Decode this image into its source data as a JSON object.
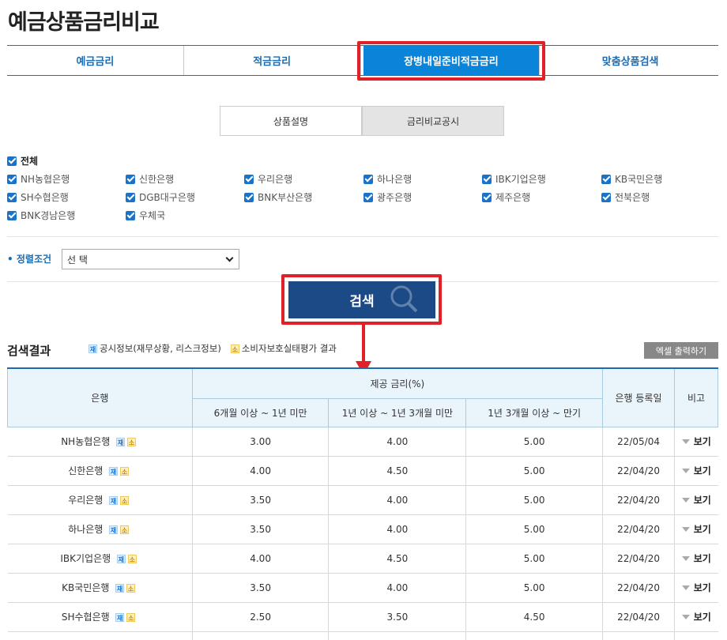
{
  "page": {
    "title": "예금상품금리비교"
  },
  "main_tabs": [
    {
      "label": "예금금리"
    },
    {
      "label": "적금금리"
    },
    {
      "label": "장병내일준비적금금리",
      "active": true
    },
    {
      "label": "맞춤상품검색"
    }
  ],
  "sub_tabs": [
    {
      "label": "상품설명"
    },
    {
      "label": "금리비교공시",
      "active": true
    }
  ],
  "banks": {
    "all_label": "전체",
    "items": [
      "NH농협은행",
      "신한은행",
      "우리은행",
      "하나은행",
      "IBK기업은행",
      "KB국민은행",
      "SH수협은행",
      "DGB대구은행",
      "BNK부산은행",
      "광주은행",
      "제주은행",
      "전북은행",
      "BNK경남은행",
      "우체국"
    ]
  },
  "sort": {
    "label": "정렬조건",
    "selected": "선 택"
  },
  "search": {
    "label": "검색"
  },
  "results": {
    "title": "검색결과",
    "legend": [
      {
        "badge": "재",
        "text": "공시정보(재무상황, 리스크정보)"
      },
      {
        "badge": "소",
        "text": "소비자보호실태평가 결과"
      }
    ],
    "excel_label": "엑셀 출력하기"
  },
  "table": {
    "headers": {
      "bank": "은행",
      "rate_group": "제공 금리(%)",
      "col1": "6개월 이상 ~ 1년 미만",
      "col2": "1년 이상 ~ 1년 3개월 미만",
      "col3": "1년 3개월 이상 ~ 만기",
      "date": "은행 등록일",
      "note": "비고"
    },
    "badge_j": "재",
    "badge_s": "소",
    "view_label": "보기",
    "rows": [
      {
        "bank": "NH농협은행",
        "r1": "3.00",
        "r2": "4.00",
        "r3": "5.00",
        "date": "22/05/04"
      },
      {
        "bank": "신한은행",
        "r1": "4.00",
        "r2": "4.50",
        "r3": "5.00",
        "date": "22/04/20"
      },
      {
        "bank": "우리은행",
        "r1": "3.50",
        "r2": "4.00",
        "r3": "5.00",
        "date": "22/04/20"
      },
      {
        "bank": "하나은행",
        "r1": "3.50",
        "r2": "4.00",
        "r3": "5.00",
        "date": "22/04/20"
      },
      {
        "bank": "IBK기업은행",
        "r1": "4.00",
        "r2": "4.50",
        "r3": "5.00",
        "date": "22/04/20"
      },
      {
        "bank": "KB국민은행",
        "r1": "3.50",
        "r2": "4.00",
        "r3": "5.00",
        "date": "22/04/20"
      },
      {
        "bank": "SH수협은행",
        "r1": "2.50",
        "r2": "3.50",
        "r3": "4.50",
        "date": "22/04/20"
      },
      {
        "bank": "",
        "r1": "",
        "r2": "",
        "r3": "",
        "date": ""
      }
    ]
  }
}
